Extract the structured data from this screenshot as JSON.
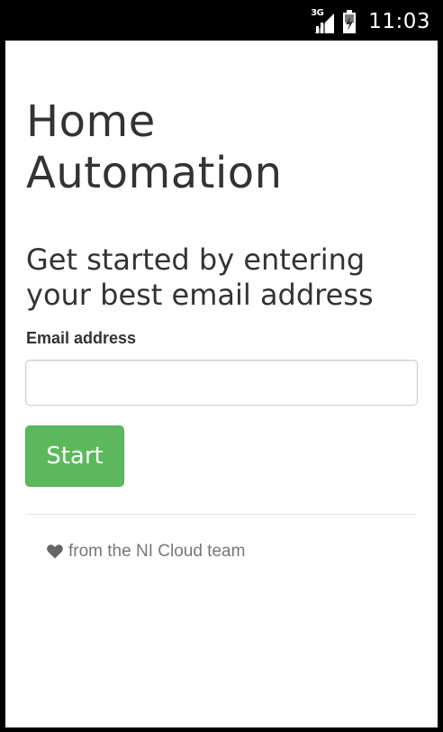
{
  "status_bar": {
    "network": "3G",
    "time": "11:03"
  },
  "app": {
    "title_line1": "Home",
    "title_line2": "Automation",
    "lead_line1": "Get started by entering",
    "lead_line2": "your best email address",
    "email_label": "Email address",
    "email_value": "",
    "email_placeholder": "",
    "start_label": "Start",
    "footer_text": "from the NI Cloud team"
  },
  "colors": {
    "primary_green": "#5cb85c",
    "text_dark": "#333333",
    "text_muted": "#777777"
  },
  "icons": {
    "signal": "signal-icon",
    "battery": "battery-charging-icon",
    "footer": "heart-icon"
  }
}
